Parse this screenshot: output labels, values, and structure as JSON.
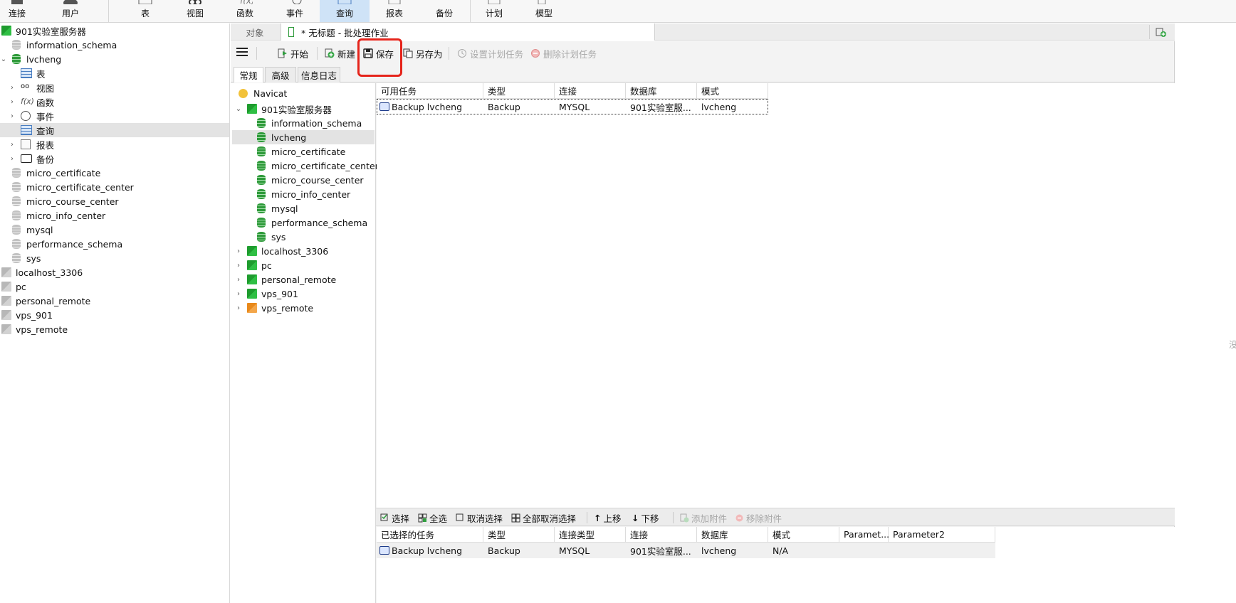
{
  "ribbon": {
    "items": [
      {
        "label": "连接",
        "icon": "connect-icon"
      },
      {
        "label": "用户",
        "icon": "user-icon"
      },
      {
        "label": "表",
        "icon": "table-icon"
      },
      {
        "label": "视图",
        "icon": "view-icon"
      },
      {
        "label": "函数",
        "icon": "function-icon"
      },
      {
        "label": "事件",
        "icon": "event-icon"
      },
      {
        "label": "查询",
        "icon": "query-icon",
        "active": true
      },
      {
        "label": "报表",
        "icon": "report-icon"
      },
      {
        "label": "备份",
        "icon": "backup-icon"
      },
      {
        "label": "计划",
        "icon": "schedule-icon"
      },
      {
        "label": "模型",
        "icon": "model-icon"
      }
    ]
  },
  "nav": {
    "server": "901实验室服务器",
    "databases_before": [
      "information_schema"
    ],
    "open_db": "lvcheng",
    "open_db_children": [
      "表",
      "视图",
      "函数",
      "事件",
      "查询",
      "报表",
      "备份"
    ],
    "databases_after": [
      "micro_certificate",
      "micro_certificate_center",
      "micro_course_center",
      "micro_info_center",
      "mysql",
      "performance_schema",
      "sys"
    ],
    "other_connections": [
      "localhost_3306",
      "pc",
      "personal_remote",
      "vps_901",
      "vps_remote"
    ]
  },
  "tabs": {
    "objects": "对象",
    "doc": "* 无标题 - 批处理作业"
  },
  "toolbar": {
    "start": "开始",
    "new": "新建",
    "save": "保存",
    "save_as": "另存为",
    "set_schedule": "设置计划任务",
    "delete_schedule": "删除计划任务"
  },
  "subtabs": [
    "常规",
    "高级",
    "信息日志"
  ],
  "tree": {
    "root": "Navicat",
    "server": "901实验室服务器",
    "databases": [
      "information_schema",
      "lvcheng",
      "micro_certificate",
      "micro_certificate_center",
      "micro_course_center",
      "micro_info_center",
      "mysql",
      "performance_schema",
      "sys"
    ],
    "selected_db": "lvcheng",
    "connections": [
      "localhost_3306",
      "pc",
      "personal_remote",
      "vps_901",
      "vps_remote"
    ]
  },
  "available": {
    "headers": [
      "可用任务",
      "类型",
      "连接",
      "数据库",
      "模式"
    ],
    "rows": [
      [
        "Backup lvcheng",
        "Backup",
        "MYSQL",
        "901实验室服...",
        "lvcheng"
      ]
    ]
  },
  "bottombar": {
    "select": "选择",
    "select_all": "全选",
    "deselect": "取消选择",
    "deselect_all": "全部取消选择",
    "move_up": "上移",
    "move_down": "下移",
    "add_attachment": "添加附件",
    "remove_attachment": "移除附件"
  },
  "selected": {
    "headers": [
      "已选择的任务",
      "类型",
      "连接类型",
      "连接",
      "数据库",
      "模式",
      "Paramet...",
      "Parameter2"
    ],
    "rows": [
      [
        "Backup lvcheng",
        "Backup",
        "MYSQL",
        "901实验室服...",
        "lvcheng",
        "N/A",
        "",
        ""
      ]
    ]
  },
  "edge_text": "没"
}
